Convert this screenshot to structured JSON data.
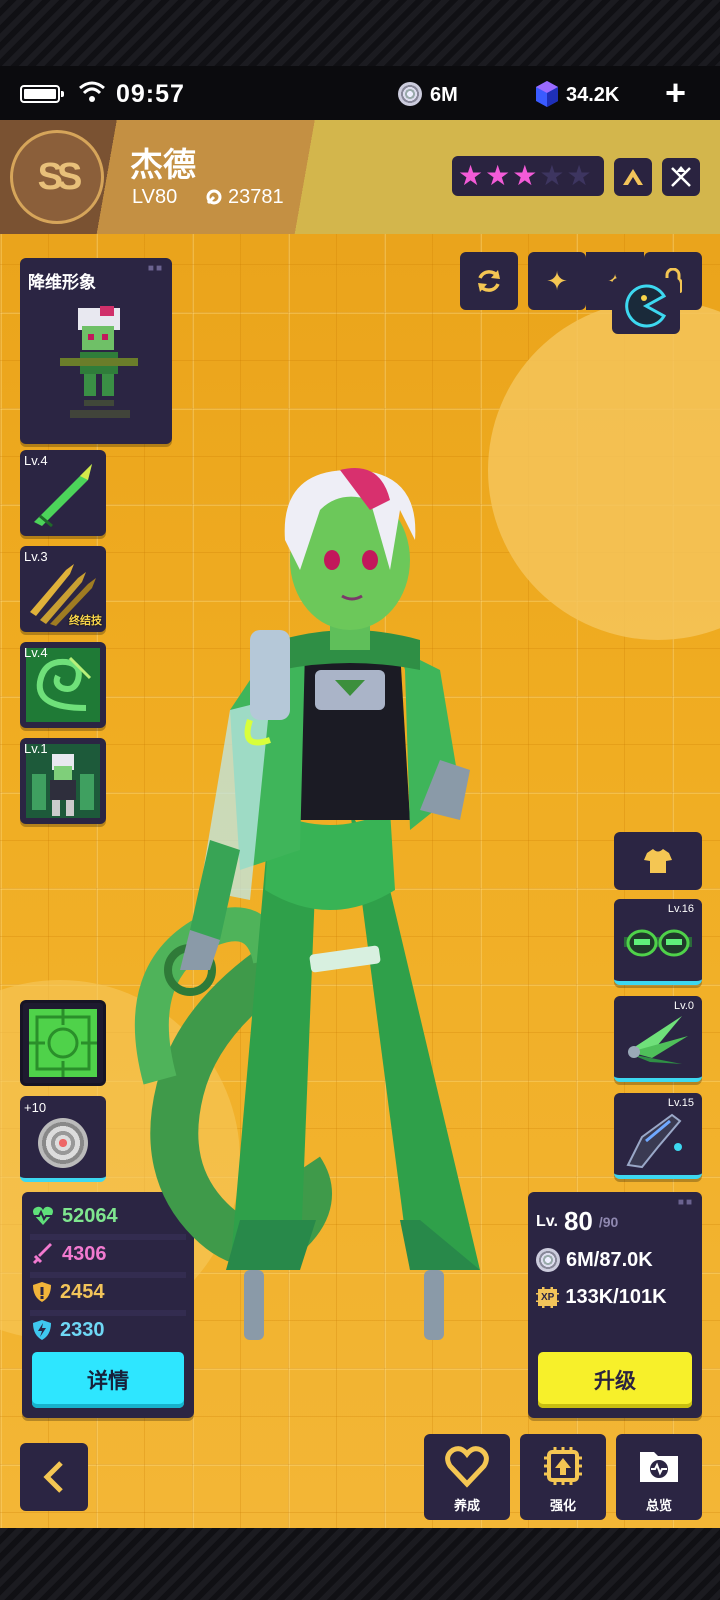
{
  "status": {
    "time": "09:57",
    "coins": "6M",
    "gems": "34.2K"
  },
  "colors": {
    "accent_cyan": "#2ee6ff",
    "accent_yellow": "#f7f02a",
    "panel": "#2b2543",
    "star_on": "#f35bd8",
    "bg_orange": "#f0ad22"
  },
  "character": {
    "name": "杰德",
    "level": "LV80",
    "power": "23781",
    "stars_filled": 3,
    "stars_total": 5
  },
  "pixel_form": {
    "title": "降维形象"
  },
  "skills": [
    {
      "level": "Lv.4",
      "tag": ""
    },
    {
      "level": "Lv.3",
      "tag": "终结技"
    },
    {
      "level": "Lv.4",
      "tag": ""
    },
    {
      "level": "Lv.1",
      "tag": ""
    }
  ],
  "module": {
    "plus": "+10"
  },
  "equipment": [
    {
      "level": "Lv.16",
      "icon": "goggles-icon"
    },
    {
      "level": "Lv.0",
      "icon": "wing-blade-icon"
    },
    {
      "level": "Lv.15",
      "icon": "gun-icon"
    }
  ],
  "stats": {
    "hp": "52064",
    "attack": "4306",
    "defense": "2454",
    "speed": "2330",
    "details_label": "详情"
  },
  "level_panel": {
    "lv_label": "Lv.",
    "current": "80",
    "max": "/90",
    "coins": "6M/87.0K",
    "xp_tag": "XP",
    "xp": "133K/101K",
    "upgrade_label": "升级"
  },
  "nav": {
    "nurture": "养成",
    "enhance": "强化",
    "overview": "总览"
  }
}
